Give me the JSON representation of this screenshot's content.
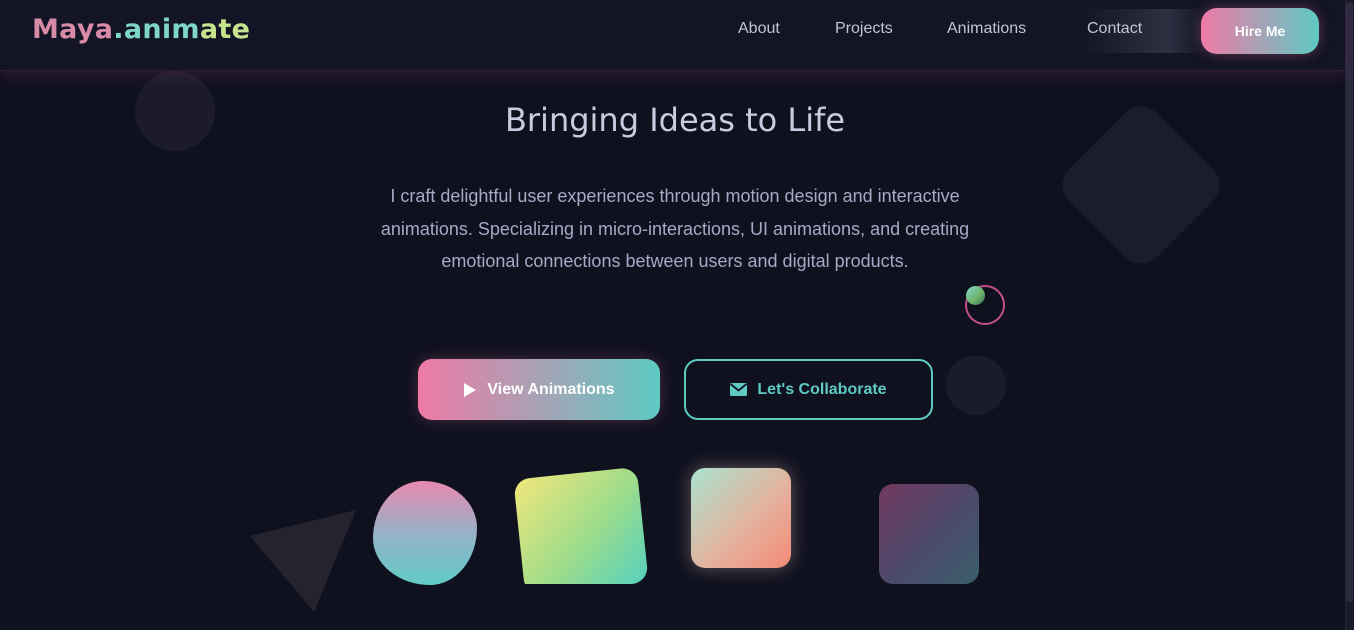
{
  "header": {
    "logo": {
      "part1": "Maya",
      "part2": ".anim",
      "part3": "ate"
    },
    "nav": [
      {
        "label": "About"
      },
      {
        "label": "Projects"
      },
      {
        "label": "Animations"
      },
      {
        "label": "Contact"
      }
    ],
    "cta_label": "Hire Me"
  },
  "hero": {
    "title": "Bringing Ideas to Life",
    "description": "I craft delightful user experiences through motion design and interactive animations. Specializing in micro-interactions, UI animations, and creating emotional connections between users and digital products.",
    "primary_button": {
      "label": "View Animations",
      "icon": "play-icon"
    },
    "secondary_button": {
      "label": "Let's Collaborate",
      "icon": "envelope-icon"
    }
  },
  "colors": {
    "background": "#10111f",
    "accent_pink": "#ef7aa6",
    "accent_teal": "#5fcac4"
  }
}
